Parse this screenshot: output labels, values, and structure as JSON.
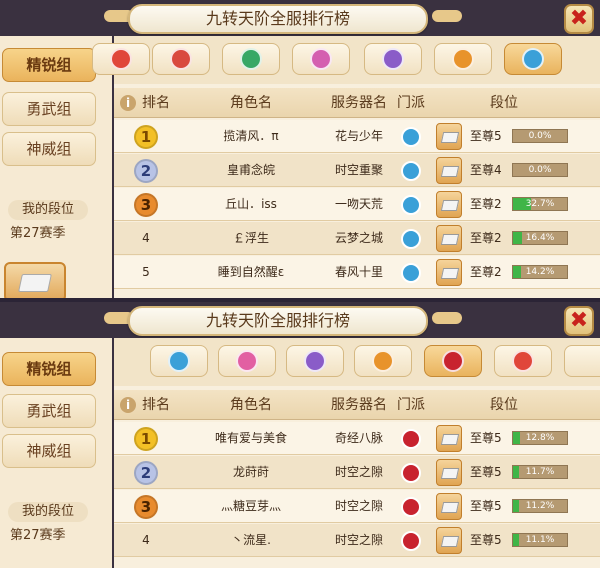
{
  "panels": [
    {
      "title": "九转天阶全服排行榜",
      "close_glyph": "✖",
      "sidebar": {
        "tabs": [
          "精锐组",
          "勇武组",
          "神威组"
        ],
        "active": 0,
        "my_rank_label": "我的段位",
        "season": "第27赛季"
      },
      "school_tabs": [
        {
          "name": "faction-icon-red",
          "color": "#e0463a",
          "active": false
        },
        {
          "name": "faction-icon-crimson",
          "color": "#d9493f",
          "active": false
        },
        {
          "name": "faction-icon-green",
          "color": "#37a866",
          "active": false
        },
        {
          "name": "faction-icon-pink",
          "color": "#d45fb0",
          "active": false
        },
        {
          "name": "faction-icon-purple",
          "color": "#8a5cc8",
          "active": false
        },
        {
          "name": "faction-icon-orange",
          "color": "#e8932b",
          "active": false
        },
        {
          "name": "faction-icon-cyan",
          "color": "#3aa0d8",
          "active": true
        }
      ],
      "columns": [
        "排名",
        "角色名",
        "服务器名",
        "门派",
        "段位"
      ],
      "rows": [
        {
          "rank": "1",
          "name": "揽清风．π",
          "server": "花与少年",
          "tier": "至尊5",
          "progress": 0.0,
          "progress_text": "0.0%",
          "faction_color": "#3aa0d8"
        },
        {
          "rank": "2",
          "name": "皇甫念皖",
          "server": "时空重聚",
          "tier": "至尊4",
          "progress": 0.0,
          "progress_text": "0.0%",
          "faction_color": "#3aa0d8"
        },
        {
          "rank": "3",
          "name": "丘山．iss",
          "server": "一吻天荒",
          "tier": "至尊2",
          "progress": 0.327,
          "progress_text": "32.7%",
          "faction_color": "#3aa0d8"
        },
        {
          "rank": "4",
          "name": "￡浮生",
          "server": "云梦之城",
          "tier": "至尊2",
          "progress": 0.164,
          "progress_text": "16.4%",
          "faction_color": "#3aa0d8"
        },
        {
          "rank": "5",
          "name": "睡到自然醒ε",
          "server": "春风十里",
          "tier": "至尊2",
          "progress": 0.142,
          "progress_text": "14.2%",
          "faction_color": "#3aa0d8"
        }
      ]
    },
    {
      "title": "九转天阶全服排行榜",
      "close_glyph": "✖",
      "sidebar": {
        "tabs": [
          "精锐组",
          "勇武组",
          "神威组"
        ],
        "active": 0,
        "my_rank_label": "我的段位",
        "season": "第27赛季"
      },
      "school_tabs": [
        {
          "name": "faction-icon-cyan",
          "color": "#3aa0d8",
          "active": false
        },
        {
          "name": "faction-icon-pink",
          "color": "#e25fa2",
          "active": false
        },
        {
          "name": "faction-icon-purple",
          "color": "#8a5cc8",
          "active": false
        },
        {
          "name": "faction-icon-orange",
          "color": "#e8932b",
          "active": false
        },
        {
          "name": "faction-icon-crimson",
          "color": "#c8232f",
          "active": true
        },
        {
          "name": "faction-icon-red",
          "color": "#e0463a",
          "active": false
        }
      ],
      "columns": [
        "排名",
        "角色名",
        "服务器名",
        "门派",
        "段位"
      ],
      "rows": [
        {
          "rank": "1",
          "name": "唯有爱与美食",
          "server": "奇经八脉",
          "tier": "至尊5",
          "progress": 0.128,
          "progress_text": "12.8%",
          "faction_color": "#c8232f"
        },
        {
          "rank": "2",
          "name": "龙莳莳",
          "server": "时空之隙",
          "tier": "至尊5",
          "progress": 0.117,
          "progress_text": "11.7%",
          "faction_color": "#c8232f"
        },
        {
          "rank": "3",
          "name": "灬糖豆芽灬",
          "server": "时空之隙",
          "tier": "至尊5",
          "progress": 0.112,
          "progress_text": "11.2%",
          "faction_color": "#c8232f"
        },
        {
          "rank": "4",
          "name": "丶流星.",
          "server": "时空之隙",
          "tier": "至尊5",
          "progress": 0.111,
          "progress_text": "11.1%",
          "faction_color": "#c8232f"
        }
      ]
    }
  ]
}
